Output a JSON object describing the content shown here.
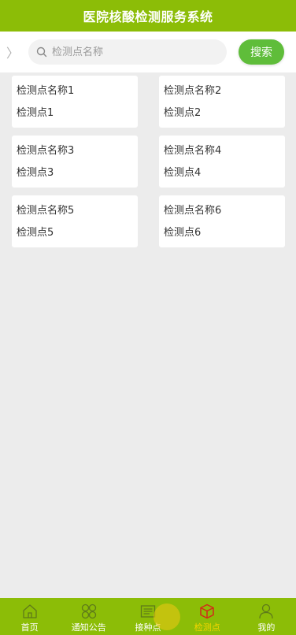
{
  "header": {
    "title": "医院核酸检测服务系统"
  },
  "search": {
    "placeholder": "检测点名称",
    "button_label": "搜索",
    "back_glyph": "〉"
  },
  "cards": [
    {
      "name": "检测点名称1",
      "point": "检测点1"
    },
    {
      "name": "检测点名称2",
      "point": "检测点2"
    },
    {
      "name": "检测点名称3",
      "point": "检测点3"
    },
    {
      "name": "检测点名称4",
      "point": "检测点4"
    },
    {
      "name": "检测点名称5",
      "point": "检测点5"
    },
    {
      "name": "检测点名称6",
      "point": "检测点6"
    }
  ],
  "tabs": [
    {
      "label": "首页",
      "icon": "home-icon"
    },
    {
      "label": "通知公告",
      "icon": "grid-icon"
    },
    {
      "label": "接种点",
      "icon": "list-icon"
    },
    {
      "label": "检测点",
      "icon": "cube-icon",
      "active": true
    },
    {
      "label": "我的",
      "icon": "user-icon"
    }
  ],
  "colors": {
    "brand_green": "#8cbd07",
    "search_button": "#5fbd3a",
    "active_tab": "#f5d400",
    "background": "#ececec"
  }
}
